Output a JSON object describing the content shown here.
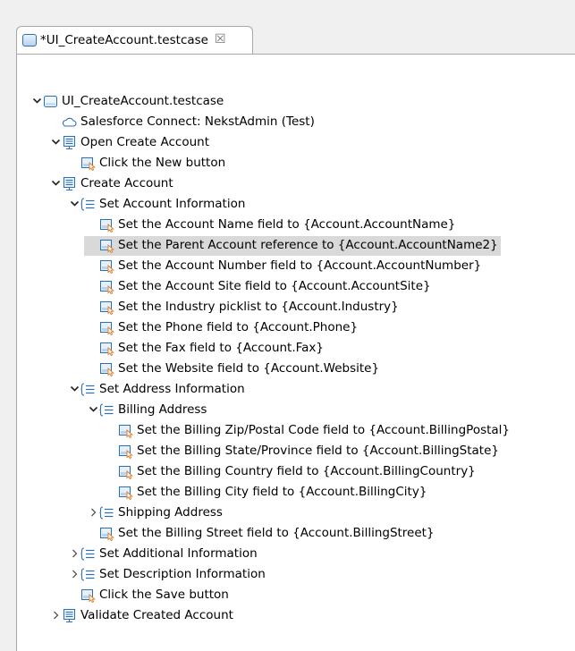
{
  "tab": {
    "title": "*UI_CreateAccount.testcase",
    "close_glyph": "☒"
  },
  "tree": [
    {
      "label": "UI_CreateAccount.testcase",
      "icon": "testcase-file-icon",
      "twisty": "expanded",
      "level": 0
    },
    {
      "label": "Salesforce Connect: NekstAdmin (Test)",
      "icon": "cloud-icon",
      "twisty": "none",
      "level": 1
    },
    {
      "label": "Open Create Account",
      "icon": "screen-icon",
      "twisty": "expanded",
      "level": 1
    },
    {
      "label": "Click the New button",
      "icon": "step-click-icon",
      "twisty": "none",
      "level": 2
    },
    {
      "label": "Create Account",
      "icon": "screen-icon",
      "twisty": "expanded",
      "level": 1
    },
    {
      "label": "Set Account Information",
      "icon": "section-list-icon",
      "twisty": "expanded",
      "level": 2
    },
    {
      "label": "Set the Account Name field to {Account.AccountName}",
      "icon": "step-click-icon",
      "twisty": "none",
      "level": 3
    },
    {
      "label": "Set the Parent Account reference to {Account.AccountName2}",
      "icon": "step-click-icon",
      "twisty": "none",
      "level": 3,
      "selected": true
    },
    {
      "label": "Set the Account Number field to {Account.AccountNumber}",
      "icon": "step-click-icon",
      "twisty": "none",
      "level": 3
    },
    {
      "label": "Set the Account Site field to {Account.AccountSite}",
      "icon": "step-click-icon",
      "twisty": "none",
      "level": 3
    },
    {
      "label": "Set the Industry picklist to {Account.Industry}",
      "icon": "step-click-icon",
      "twisty": "none",
      "level": 3
    },
    {
      "label": "Set the Phone field to {Account.Phone}",
      "icon": "step-click-icon",
      "twisty": "none",
      "level": 3
    },
    {
      "label": "Set the Fax field to {Account.Fax}",
      "icon": "step-click-icon",
      "twisty": "none",
      "level": 3
    },
    {
      "label": "Set the Website field to {Account.Website}",
      "icon": "step-click-icon",
      "twisty": "none",
      "level": 3
    },
    {
      "label": "Set Address Information",
      "icon": "section-list-icon",
      "twisty": "expanded",
      "level": 2
    },
    {
      "label": "Billing Address",
      "icon": "section-list-icon",
      "twisty": "expanded",
      "level": 3
    },
    {
      "label": "Set the Billing Zip/Postal Code field to {Account.BillingPostal}",
      "icon": "step-click-icon",
      "twisty": "none",
      "level": 4
    },
    {
      "label": "Set the Billing State/Province field to {Account.BillingState}",
      "icon": "step-click-icon",
      "twisty": "none",
      "level": 4
    },
    {
      "label": "Set the Billing Country field to {Account.BillingCountry}",
      "icon": "step-click-icon",
      "twisty": "none",
      "level": 4
    },
    {
      "label": "Set the Billing City field to {Account.BillingCity}",
      "icon": "step-click-icon",
      "twisty": "none",
      "level": 4
    },
    {
      "label": "Shipping Address",
      "icon": "section-list-icon",
      "twisty": "collapsed",
      "level": 3
    },
    {
      "label": "Set the Billing Street field to {Account.BillingStreet}",
      "icon": "step-click-icon",
      "twisty": "none",
      "level": 3
    },
    {
      "label": "Set Additional Information",
      "icon": "section-list-icon",
      "twisty": "collapsed",
      "level": 2
    },
    {
      "label": "Set Description Information",
      "icon": "section-list-icon",
      "twisty": "collapsed",
      "level": 2
    },
    {
      "label": "Click the Save button",
      "icon": "step-click-icon",
      "twisty": "none",
      "level": 2
    },
    {
      "label": "Validate Created Account",
      "icon": "screen-icon",
      "twisty": "collapsed",
      "level": 1
    }
  ],
  "colors": {
    "selection": "#d9d9d9",
    "icon_blue": "#2b70b5",
    "icon_orange": "#e07a1f",
    "twisty": "#555555"
  }
}
